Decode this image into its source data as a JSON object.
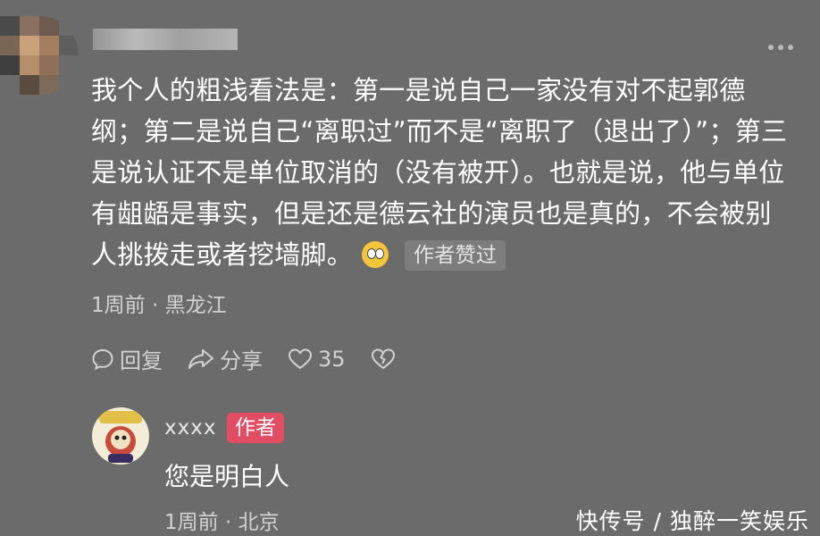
{
  "comment": {
    "text": "我个人的粗浅看法是：第一是说自己一家没有对不起郭德纲；第二是说自己“离职过”而不是“离职了（退出了）”；第三是说认证不是单位取消的（没有被开）。也就是说，他与单位有龃龉是事实，但是还是德云社的演员也是真的，不会被别人挑拨走或者挖墙脚。",
    "emoji": "eye-roll-emoji",
    "liked_badge": "作者赞过",
    "meta": "1周前 · 黑龙江"
  },
  "actions": {
    "reply_label": "回复",
    "share_label": "分享",
    "like_count": "35"
  },
  "reply": {
    "username": "xxxx",
    "author_badge": "作者",
    "text": "您是明白人",
    "meta": "1周前 · 北京"
  },
  "watermark": "快传号 / 独醉一笑娱乐",
  "colors": {
    "background": "#6b6b6b",
    "author_badge": "#e14d62",
    "muted_text": "#d2d2d2"
  }
}
